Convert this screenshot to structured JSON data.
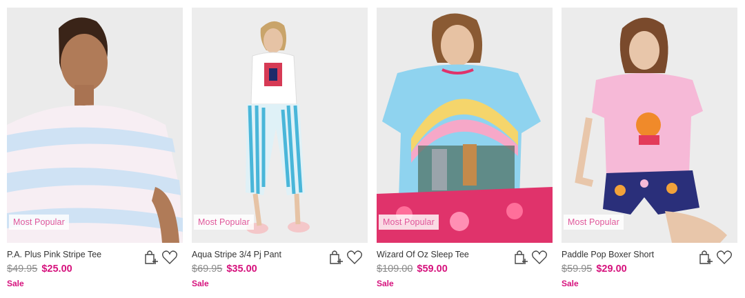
{
  "products": [
    {
      "name": "P.A. Plus Pink Stripe Tee",
      "was_price": "$49.95",
      "now_price": "$25.00",
      "sale_label": "Sale",
      "badge": "Most Popular",
      "image_alt": "woman in pastel pink and blue striped tee"
    },
    {
      "name": "Aqua Stripe 3/4 Pj Pant",
      "was_price": "$69.95",
      "now_price": "$35.00",
      "sale_label": "Sale",
      "badge": "Most Popular",
      "image_alt": "woman in white graphic tee and aqua striped pj pants"
    },
    {
      "name": "Wizard Of Oz Sleep Tee",
      "was_price": "$109.00",
      "now_price": "$59.00",
      "sale_label": "Sale",
      "badge": "Most Popular",
      "image_alt": "woman in rainbow Wizard of Oz sleep tee"
    },
    {
      "name": "Paddle Pop Boxer Short",
      "was_price": "$59.95",
      "now_price": "$29.00",
      "sale_label": "Sale",
      "badge": "Most Popular",
      "image_alt": "woman in pink tee and navy Paddle Pop boxer shorts"
    }
  ],
  "icons": {
    "bag": "add-to-bag-icon",
    "wishlist": "heart-icon"
  },
  "colors": {
    "sale": "#d6127d",
    "badge_text": "#e0579a",
    "was_price": "#8a8a8a"
  }
}
